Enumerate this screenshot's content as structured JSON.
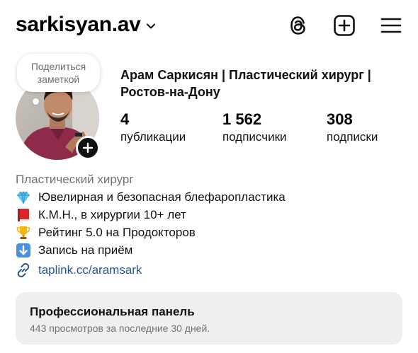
{
  "header": {
    "username": "sarkisyan.av",
    "icons": [
      "chevron-down-icon",
      "threads-icon",
      "new-post-icon",
      "menu-icon"
    ]
  },
  "note": {
    "placeholder": "Поделиться заметкой"
  },
  "profile": {
    "full_name": "Арам Саркисян | Пластический хирург | Ростов-на-Дону",
    "stats": {
      "posts": {
        "value": "4",
        "label": "публикации"
      },
      "followers": {
        "value": "1 562",
        "label": "подписчики"
      },
      "following": {
        "value": "308",
        "label": "подписки"
      }
    }
  },
  "bio": {
    "category": "Пластический хирург",
    "lines": [
      {
        "icon": "gem-icon",
        "text": "Ювелирная и безопасная блефаропластика"
      },
      {
        "icon": "book-icon",
        "text": "К.М.Н., в хирургии 10+ лет"
      },
      {
        "icon": "trophy-icon",
        "text": "Рейтинг 5.0 на Продокторов"
      },
      {
        "icon": "down-arrow-icon",
        "text": "Запись на приём"
      }
    ],
    "link": "taplink.cc/aramsark"
  },
  "professional_panel": {
    "title": "Профессиональная панель",
    "subtitle": "443 просмотров за последние 30 дней."
  },
  "colors": {
    "link": "#2b5590",
    "secondary_text": "#737373",
    "panel_bg": "#efeff0"
  }
}
